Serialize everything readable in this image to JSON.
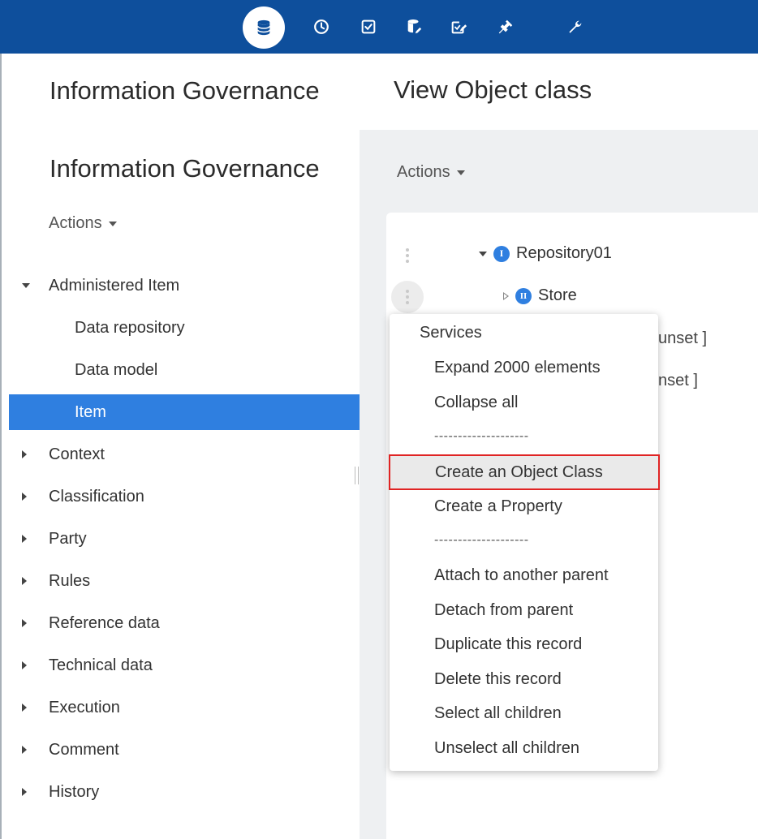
{
  "toolbar": {
    "icons": [
      "database-icon",
      "clock-icon",
      "checkbox-icon",
      "database-edit-icon",
      "checkbox-edit-icon",
      "plug-icon",
      "wrench-icon"
    ],
    "accent": "#0e4f9c"
  },
  "left": {
    "title": "Information Governance",
    "subtitle": "Information Governance",
    "actions_label": "Actions",
    "nav": [
      {
        "label": "Administered Item",
        "expanded": true
      },
      {
        "label": "Data repository",
        "child": true
      },
      {
        "label": "Data model",
        "child": true
      },
      {
        "label": "Item",
        "child": true,
        "selected": true
      },
      {
        "label": "Context"
      },
      {
        "label": "Classification"
      },
      {
        "label": "Party"
      },
      {
        "label": "Rules"
      },
      {
        "label": "Reference data"
      },
      {
        "label": "Technical data"
      },
      {
        "label": "Execution"
      },
      {
        "label": "Comment"
      },
      {
        "label": "History"
      }
    ],
    "selected_color": "#2f7fe0"
  },
  "right": {
    "title": "View Object class",
    "actions_label": "Actions",
    "tree": [
      {
        "label": "Repository01",
        "badge": "I"
      },
      {
        "label": "Store",
        "badge": "II"
      }
    ],
    "partial_values": [
      "unset ]",
      "nset ]"
    ]
  },
  "context_menu": {
    "header": "Services",
    "items": [
      "Expand 2000 elements",
      "Collapse all",
      "--------------------",
      "Create an Object Class",
      "Create a Property",
      "--------------------",
      "Attach to another parent",
      "Detach from parent",
      "Duplicate this record",
      "Delete this record",
      "Select all children",
      "Unselect all children"
    ],
    "highlighted": "Create an Object Class",
    "highlight_color": "#e02424"
  }
}
